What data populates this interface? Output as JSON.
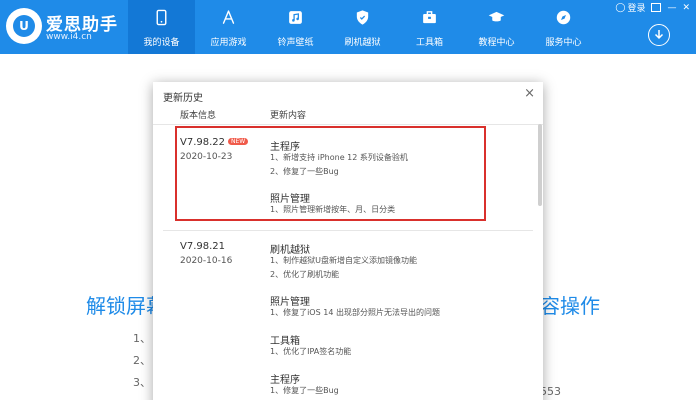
{
  "app": {
    "brand": "爱思助手",
    "logo_mark": "U",
    "url": "www.i4.cn",
    "colors": {
      "primary": "#1f8be8",
      "active_nav": "#1378d6",
      "highlight": "#d9302c",
      "badge": "#f05a4a"
    }
  },
  "window_controls": {
    "login": "登录"
  },
  "nav": [
    {
      "label": "我的设备",
      "icon": "phone-icon",
      "active": true
    },
    {
      "label": "应用游戏",
      "icon": "app-store-icon"
    },
    {
      "label": "铃声壁纸",
      "icon": "music-icon"
    },
    {
      "label": "刷机越狱",
      "icon": "shield-icon"
    },
    {
      "label": "工具箱",
      "icon": "toolbox-icon"
    },
    {
      "label": "教程中心",
      "icon": "graduation-cap-icon"
    },
    {
      "label": "服务中心",
      "icon": "compass-icon"
    }
  ],
  "background": {
    "title_left": "解锁屏幕",
    "title_right": "内容操作",
    "items": [
      "1、",
      "2、",
      "3、"
    ],
    "partial_number": "553"
  },
  "dialog": {
    "title": "更新历史",
    "col_version": "版本信息",
    "col_content": "更新内容",
    "entries": [
      {
        "version": "V7.98.22",
        "badge": "NEW",
        "date": "2020-10-23",
        "sections": [
          {
            "title": "主程序",
            "lines": [
              "1、新增支持 iPhone 12 系列设备验机",
              "2、修复了一些Bug"
            ]
          },
          {
            "title": "照片管理",
            "lines": [
              "1、照片管理新增按年、月、日分类"
            ]
          }
        ]
      },
      {
        "version": "V7.98.21",
        "date": "2020-10-16",
        "sections": [
          {
            "title": "刷机越狱",
            "lines": [
              "1、制作越狱U盘新增自定义添加镜像功能",
              "2、优化了刷机功能"
            ]
          },
          {
            "title": "照片管理",
            "lines": [
              "1、修复了iOS 14 出现部分照片无法导出的问题"
            ]
          },
          {
            "title": "工具箱",
            "lines": [
              "1、优化了IPA签名功能"
            ]
          },
          {
            "title": "主程序",
            "lines": [
              "1、修复了一些Bug"
            ]
          }
        ]
      }
    ]
  }
}
